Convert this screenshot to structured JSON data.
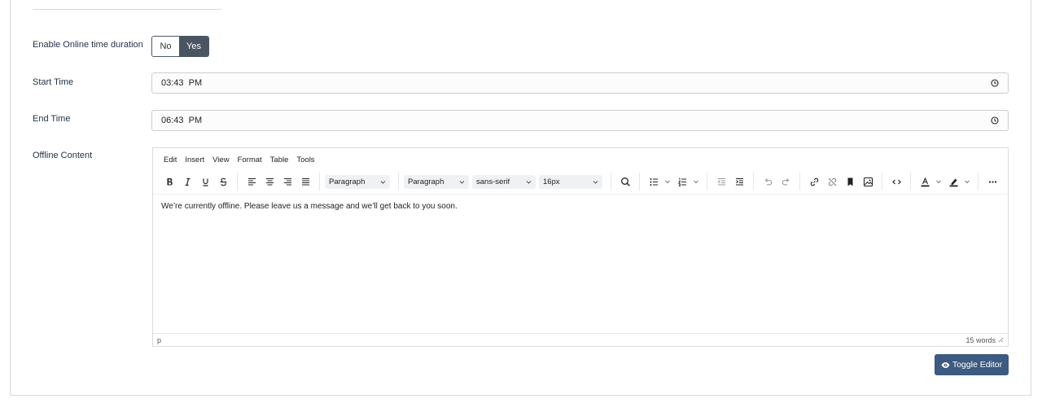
{
  "form": {
    "online_duration": {
      "label": "Enable Online time duration",
      "options": [
        "No",
        "Yes"
      ],
      "selected": "Yes"
    },
    "start_time": {
      "label": "Start Time",
      "value": "03:43  PM"
    },
    "end_time": {
      "label": "End Time",
      "value": "06:43  PM"
    },
    "offline_content": {
      "label": "Offline Content"
    }
  },
  "editor": {
    "menu": [
      "Edit",
      "Insert",
      "View",
      "Format",
      "Table",
      "Tools"
    ],
    "dropdowns": {
      "block_format": "Paragraph",
      "style": "Paragraph",
      "font_family": "sans-serif",
      "font_size": "16px"
    },
    "content": "We’re currently offline. Please leave us a message and we’ll get back to you soon.",
    "status_path": "p",
    "word_count": "15 words"
  },
  "actions": {
    "toggle_editor": "Toggle Editor"
  },
  "colors": {
    "accent": "#3d5a80",
    "toggle_active": "#4a5562"
  }
}
